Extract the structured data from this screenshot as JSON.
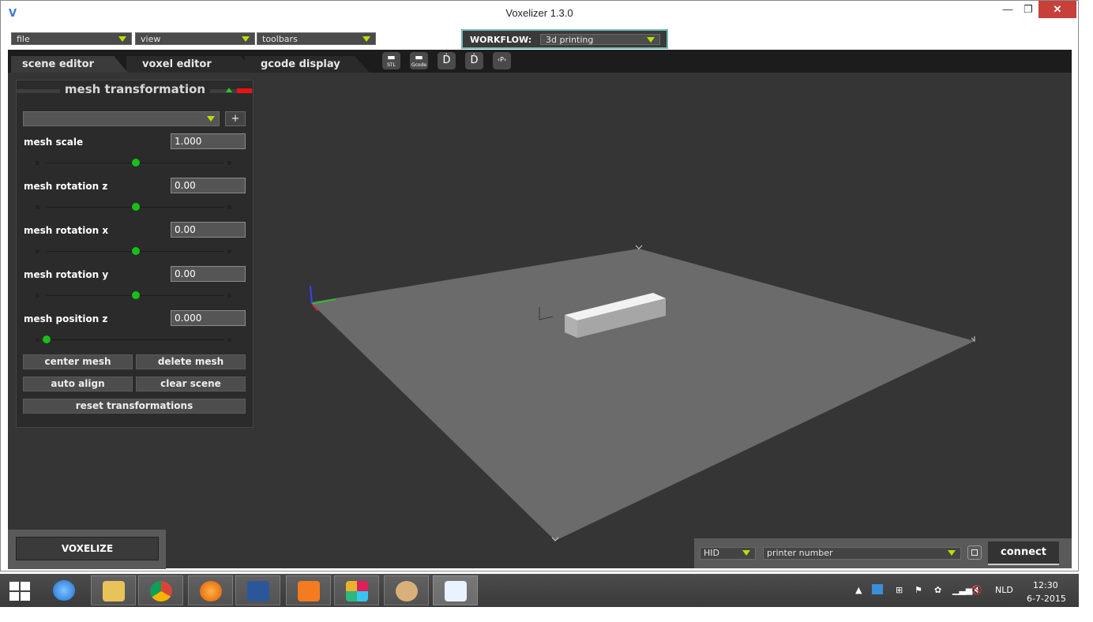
{
  "window": {
    "title": "Voxelizer 1.3.0",
    "min_glyph": "—",
    "max_glyph": "❐",
    "close_glyph": "✕"
  },
  "menus": {
    "file": "file",
    "view": "view",
    "toolbars": "toolbars"
  },
  "workflow": {
    "label": "WORKFLOW:",
    "value": "3d printing"
  },
  "tabs": [
    "scene editor",
    "voxel editor",
    "gcode display"
  ],
  "toolbar": {
    "buttons": [
      {
        "icon": "folder-stl-icon",
        "label": "STL"
      },
      {
        "icon": "folder-gcode-icon",
        "label": "Gcode"
      },
      {
        "icon": "download-icon",
        "label": ""
      },
      {
        "icon": "upload-icon",
        "label": ""
      },
      {
        "icon": "p-icon",
        "label": "P"
      }
    ]
  },
  "panel": {
    "title": "mesh transformation",
    "add_label": "+",
    "rows": [
      {
        "label": "mesh scale",
        "value": "1.000",
        "slider": 0.5
      },
      {
        "label": "mesh rotation z",
        "value": "0.00",
        "slider": 0.5
      },
      {
        "label": "mesh rotation x",
        "value": "0.00",
        "slider": 0.5
      },
      {
        "label": "mesh rotation y",
        "value": "0.00",
        "slider": 0.5
      },
      {
        "label": "mesh position z",
        "value": "0.000",
        "slider": 0.0
      }
    ],
    "buttons": {
      "center": "center mesh",
      "delete": "delete mesh",
      "auto_align": "auto align",
      "clear": "clear scene",
      "reset": "reset transformations"
    }
  },
  "voxelize_label": "VOXELIZE",
  "printer": {
    "port": "HID",
    "number": "printer number",
    "connect": "connect"
  },
  "taskbar": {
    "lang": "NLD",
    "time": "12:30",
    "date": "6-7-2015",
    "apps": [
      "internet-explorer-icon",
      "file-explorer-icon",
      "chrome-icon",
      "firefox-icon",
      "word-icon",
      "pdf-icon",
      "slack-icon",
      "paint-icon",
      "voxelizer-icon"
    ]
  },
  "colors": {
    "accent_green": "#17c017",
    "workflow_border": "#6fb8b3",
    "close_red": "#c7403a",
    "dropdown_arrow": "#b8e000"
  }
}
